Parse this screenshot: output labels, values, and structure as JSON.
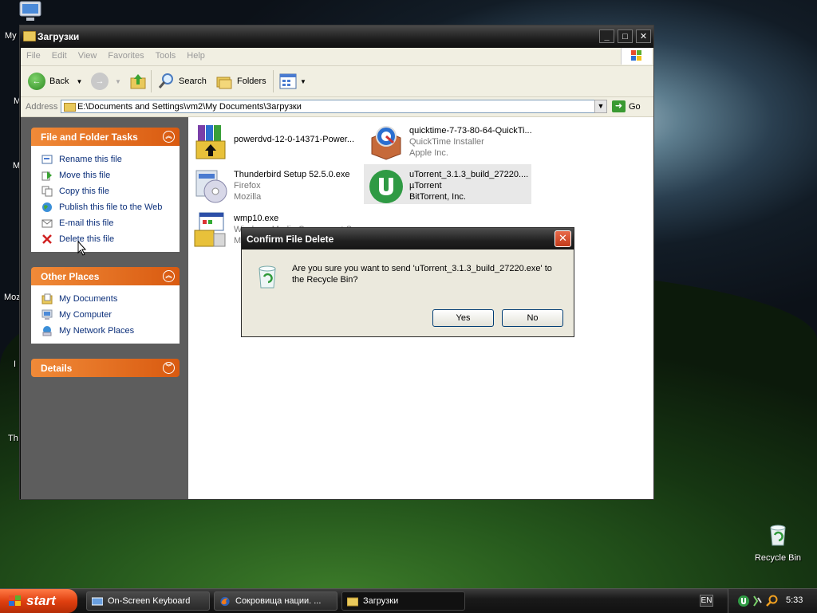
{
  "desktop": {
    "my_computer_label": "My",
    "recycle_bin_label": "Recycle Bin",
    "side_labels": [
      "M",
      "M",
      "Moz",
      "I",
      "Th"
    ]
  },
  "window": {
    "title": "Загрузки",
    "menu": [
      "File",
      "Edit",
      "View",
      "Favorites",
      "Tools",
      "Help"
    ],
    "toolbar": {
      "back": "Back",
      "search": "Search",
      "folders": "Folders"
    },
    "address": {
      "label": "Address",
      "value": "E:\\Documents and Settings\\vm2\\My Documents\\Загрузки",
      "go": "Go"
    }
  },
  "tasks_panel": {
    "title": "File and Folder Tasks",
    "items": [
      {
        "label": "Rename this file",
        "icon": "rename-icon"
      },
      {
        "label": "Move this file",
        "icon": "move-icon"
      },
      {
        "label": "Copy this file",
        "icon": "copy-icon"
      },
      {
        "label": "Publish this file to the Web",
        "icon": "globe-icon"
      },
      {
        "label": "E-mail this file",
        "icon": "email-icon"
      },
      {
        "label": "Delete this file",
        "icon": "delete-icon"
      }
    ]
  },
  "places_panel": {
    "title": "Other Places",
    "items": [
      {
        "label": "My Documents",
        "icon": "my-documents-icon"
      },
      {
        "label": "My Computer",
        "icon": "my-computer-icon"
      },
      {
        "label": "My Network Places",
        "icon": "network-icon"
      }
    ]
  },
  "details_panel": {
    "title": "Details"
  },
  "files": [
    {
      "name": "powerdvd-12-0-14371-Power...",
      "line2": "",
      "line3": "",
      "icon": "winrar-archive-icon"
    },
    {
      "name": "quicktime-7-73-80-64-QuickTi...",
      "line2": "QuickTime Installer",
      "line3": "Apple Inc.",
      "icon": "quicktime-icon"
    },
    {
      "name": "Thunderbird Setup 52.5.0.exe",
      "line2": "Firefox",
      "line3": "Mozilla",
      "icon": "installer-cd-icon"
    },
    {
      "name": "uTorrent_3.1.3_build_27220....",
      "line2": "µTorrent",
      "line3": "BitTorrent, Inc.",
      "icon": "utorrent-icon",
      "selected": true
    },
    {
      "name": "wmp10.exe",
      "line2": "Windows Media Component S...",
      "line3": "M",
      "icon": "setup-exe-icon"
    }
  ],
  "dialog": {
    "title": "Confirm File Delete",
    "message": "Are you sure you want to send 'uTorrent_3.1.3_build_27220.exe' to the Recycle Bin?",
    "yes": "Yes",
    "no": "No"
  },
  "taskbar": {
    "start": "start",
    "buttons": [
      {
        "label": "On-Screen Keyboard",
        "icon": "keyboard-icon"
      },
      {
        "label": "Сокровища нации. ...",
        "icon": "firefox-icon"
      },
      {
        "label": "Загрузки",
        "icon": "folder-icon",
        "active": true
      }
    ],
    "language": "EN",
    "clock": "5:33"
  },
  "colors": {
    "panel_header": "#e06a1c",
    "link_text": "#0b2f7a",
    "selection": "#e8e8e8"
  }
}
